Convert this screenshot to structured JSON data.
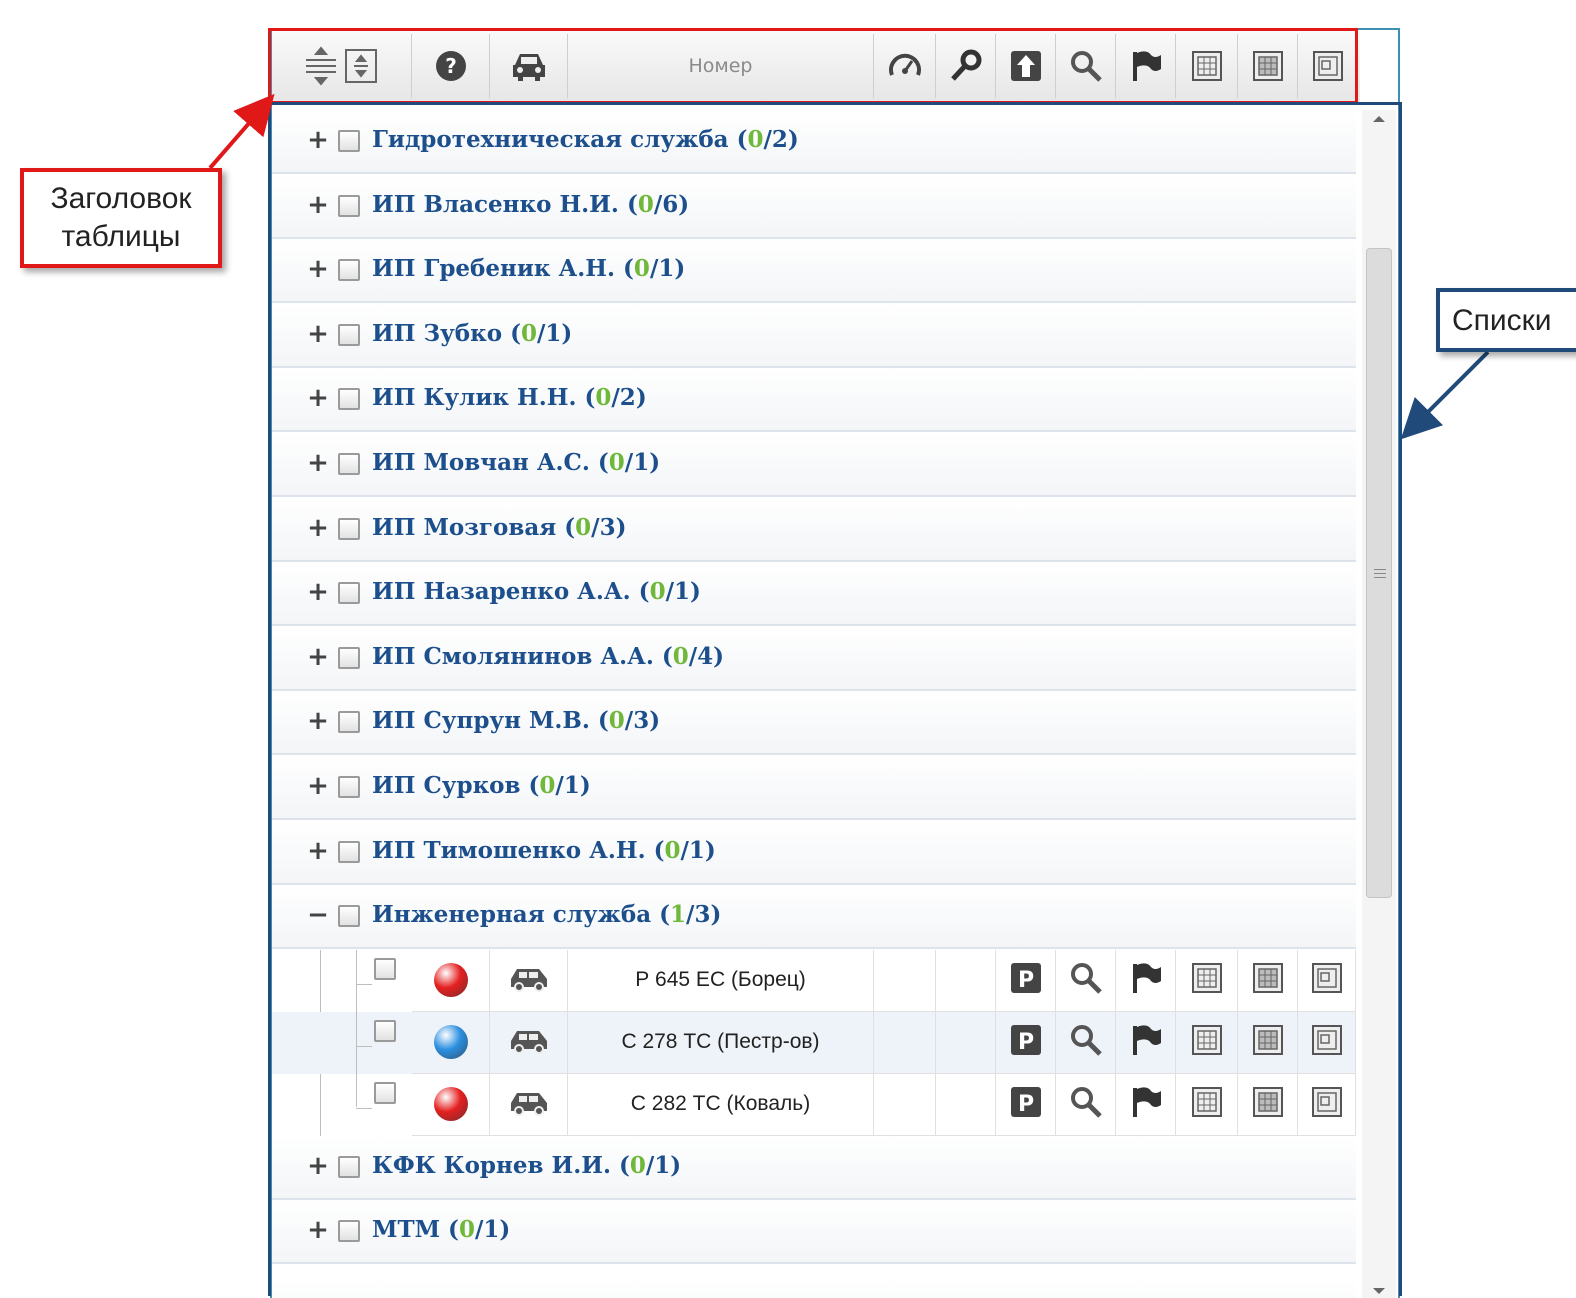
{
  "header": {
    "number_label": "Номер",
    "icons": [
      "collapse-expand-icon",
      "help-icon",
      "car-icon",
      "speedometer-icon",
      "key-icon",
      "upload-arrow-icon",
      "search-icon",
      "flag-icon",
      "grid-report-icon",
      "grid-report-icon",
      "calendar-report-icon"
    ]
  },
  "groups_top": [
    {
      "name": "Гидротехническая служба",
      "online": "0",
      "total": "2"
    },
    {
      "name": "ИП Власенко Н.И.",
      "online": "0",
      "total": "6"
    },
    {
      "name": "ИП Гребеник А.Н.",
      "online": "0",
      "total": "1"
    },
    {
      "name": "ИП Зубко",
      "online": "0",
      "total": "1"
    },
    {
      "name": "ИП Кулик Н.Н.",
      "online": "0",
      "total": "2"
    },
    {
      "name": "ИП Мовчан А.С.",
      "online": "0",
      "total": "1"
    },
    {
      "name": "ИП Мозговая",
      "online": "0",
      "total": "3"
    },
    {
      "name": "ИП Назаренко А.А.",
      "online": "0",
      "total": "1"
    },
    {
      "name": "ИП Смолянинов А.А.",
      "online": "0",
      "total": "4"
    },
    {
      "name": "ИП Супрун М.В.",
      "online": "0",
      "total": "3"
    },
    {
      "name": "ИП Сурков",
      "online": "0",
      "total": "1"
    },
    {
      "name": "ИП Тимошенко А.Н.",
      "online": "0",
      "total": "1"
    },
    {
      "name": "Инженерная служба",
      "online": "1",
      "total": "3"
    }
  ],
  "expanded_vehicles": [
    {
      "number": "Р 645 ЕС (Борец)",
      "status_color": "#e52020"
    },
    {
      "number": "С 278 ТС (Пестр-ов)",
      "status_color": "#2b8fe0"
    },
    {
      "number": "С 282 ТС (Коваль)",
      "status_color": "#e52020"
    }
  ],
  "groups_bottom": [
    {
      "name": "КФК Корнев И.И.",
      "online": "0",
      "total": "1"
    },
    {
      "name": "МТМ",
      "online": "0",
      "total": "1"
    }
  ],
  "annotations": {
    "header_callout": "Заголовок таблицы",
    "header_callout_line1": "Заголовок",
    "header_callout_line2": "таблицы",
    "list_callout": "Списки"
  },
  "colors": {
    "group_text": "#1c4f8c",
    "online_count": "#6fb83a",
    "header_frame": "#e01818",
    "list_frame": "#1f4a7a"
  }
}
